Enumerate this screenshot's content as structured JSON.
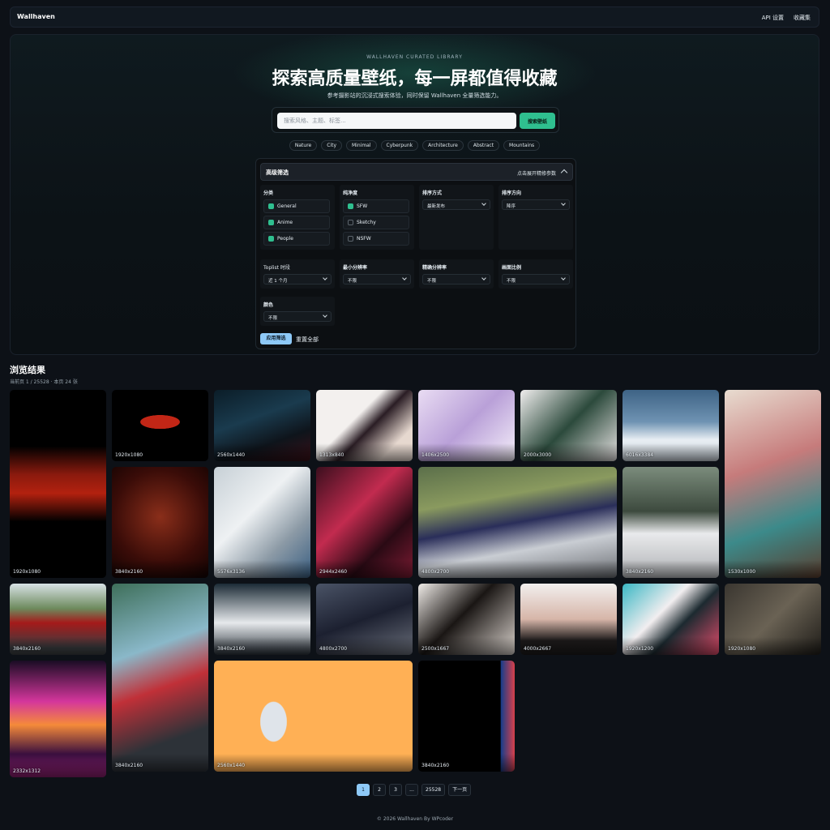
{
  "nav": {
    "brand": "Wallhaven",
    "links": [
      "API 设置",
      "收藏集"
    ]
  },
  "hero": {
    "eyebrow": "WALLHAVEN CURATED LIBRARY",
    "title": "探索高质量壁纸，每一屏都值得收藏",
    "subtitle": "参考摄影站的沉浸式搜索体验，同时保留 Wallhaven 全量筛选能力。",
    "search_placeholder": "搜索风格、主题、标签...",
    "search_button": "搜索壁纸",
    "tags": [
      "Nature",
      "City",
      "Minimal",
      "Cyberpunk",
      "Architecture",
      "Abstract",
      "Mountains"
    ]
  },
  "filter": {
    "title": "高级筛选",
    "hint": "点击展开精修参数",
    "category_label": "分类",
    "categories": [
      {
        "label": "General",
        "checked": true
      },
      {
        "label": "Anime",
        "checked": true
      },
      {
        "label": "People",
        "checked": true
      }
    ],
    "purity_label": "纯净度",
    "purity": [
      {
        "label": "SFW",
        "checked": true
      },
      {
        "label": "Sketchy",
        "checked": false
      },
      {
        "label": "NSFW",
        "checked": false
      }
    ],
    "sort_label": "排序方式",
    "sort_value": "最新发布",
    "order_label": "排序方向",
    "order_value": "降序",
    "toplist_label": "Toplist 时段",
    "toplist_value": "近 1 个月",
    "minres_label": "最小分辨率",
    "minres_value": "不限",
    "exactres_label": "精确分辨率",
    "exactres_value": "不限",
    "ratio_label": "画面比例",
    "ratio_value": "不限",
    "color_label": "颜色",
    "color_value": "不限",
    "apply": "应用筛选",
    "reset": "重置全部"
  },
  "results": {
    "title": "浏览结果",
    "meta": "当前页 1 / 25528 · 本页 24 张",
    "tiles": [
      {
        "res": "1920x1080"
      },
      {
        "res": "1920x1080"
      },
      {
        "res": "2560x1440"
      },
      {
        "res": "1313x840"
      },
      {
        "res": "1406x2500"
      },
      {
        "res": "2000x3000"
      },
      {
        "res": "6016x3384"
      },
      {
        "res": "1530x1000"
      },
      {
        "res": "3840x2160"
      },
      {
        "res": "5576x3136"
      },
      {
        "res": "2944x2460"
      },
      {
        "res": "4800x2700"
      },
      {
        "res": "3840x2160"
      },
      {
        "res": "3840x2160"
      },
      {
        "res": "3840x2160"
      },
      {
        "res": "3840x2160"
      },
      {
        "res": "4800x2700"
      },
      {
        "res": "2500x1667"
      },
      {
        "res": "4000x2667"
      },
      {
        "res": "1920x1200"
      },
      {
        "res": "1920x1080"
      },
      {
        "res": "2332x1312"
      },
      {
        "res": "2560x1440"
      },
      {
        "res": "3840x2160"
      }
    ]
  },
  "pager": {
    "pages": [
      "1",
      "2",
      "3",
      "...",
      "25528",
      "下一页"
    ],
    "active": "1"
  },
  "footer": "© 2026 Wallhaven By WPcoder"
}
